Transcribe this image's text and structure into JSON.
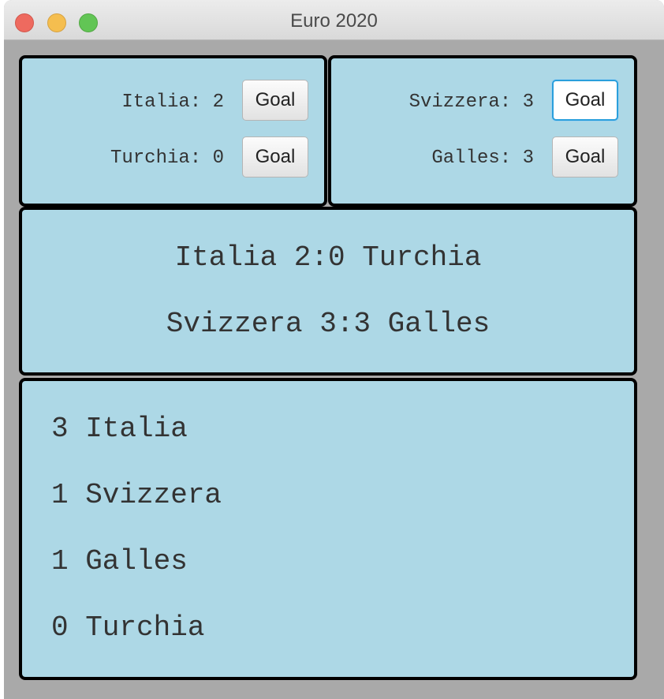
{
  "window": {
    "title": "Euro 2020"
  },
  "colors": {
    "panel_background": "#add8e6",
    "panel_border": "#000000",
    "window_background": "#a9a9a9",
    "focus_ring": "#2a9fdc"
  },
  "match1": {
    "team1_label": "Italia: 2",
    "team2_label": "Turchia: 0",
    "goal_label": "Goal"
  },
  "match2": {
    "team1_label": "Svizzera: 3",
    "team2_label": "Galles: 3",
    "goal_label": "Goal"
  },
  "results": [
    "Italia 2:0 Turchia",
    "Svizzera 3:3 Galles"
  ],
  "standings": [
    "3 Italia",
    "1 Svizzera",
    "1 Galles",
    "0 Turchia"
  ]
}
